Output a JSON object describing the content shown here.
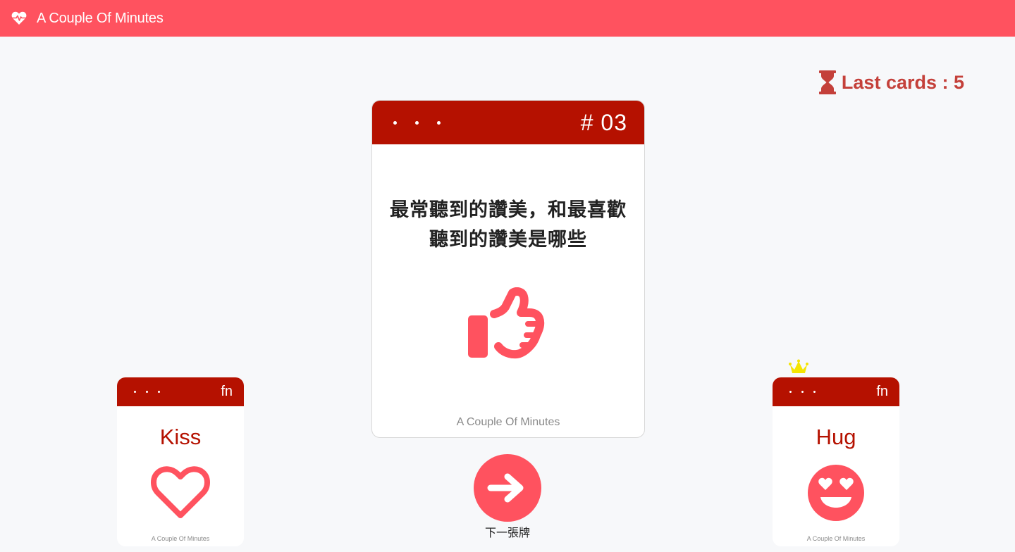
{
  "navbar": {
    "title": "A Couple Of Minutes",
    "icon": "heartbeat-icon"
  },
  "status": {
    "last_cards_text": "Last cards : 5",
    "icon": "hourglass-icon"
  },
  "main_card": {
    "number": "# 03",
    "question_line1": "最常聽到的讚美，和最喜歡",
    "question_line2": "聽到的讚美是哪些",
    "icon": "thumbs-up-icon",
    "footer": "A Couple Of Minutes"
  },
  "side_cards": [
    {
      "number": "fn",
      "title": "Kiss",
      "icon": "heart-outline-icon",
      "footer": "A Couple Of Minutes",
      "crowned": false
    },
    {
      "number": "fn",
      "title": "Hug",
      "icon": "grin-hearts-icon",
      "footer": "A Couple Of Minutes",
      "crowned": true
    }
  ],
  "next_button": {
    "label": "下一張牌",
    "icon": "arrow-right-icon"
  },
  "colors": {
    "brand": "#ff525f",
    "card_header": "#b51100",
    "status_text": "#c4403a",
    "crown": "#f5e400"
  }
}
